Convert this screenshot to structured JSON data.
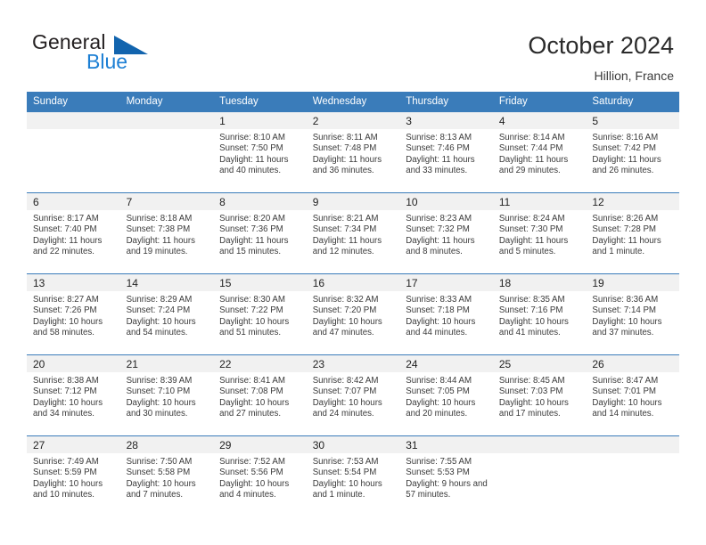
{
  "brand": {
    "name_top": "General",
    "name_bottom": "Blue",
    "accent_color": "#1c7fd4",
    "triangle_color": "#1264ae"
  },
  "header": {
    "title": "October 2024",
    "location": "Hillion, France",
    "header_bg": "#3a7cba",
    "band_bg": "#f1f1f1"
  },
  "weekdays": [
    {
      "label": "Sunday"
    },
    {
      "label": "Monday"
    },
    {
      "label": "Tuesday"
    },
    {
      "label": "Wednesday"
    },
    {
      "label": "Thursday"
    },
    {
      "label": "Friday"
    },
    {
      "label": "Saturday"
    }
  ],
  "weeks": [
    [
      {
        "day": "",
        "sunrise": "",
        "sunset": "",
        "daylight": ""
      },
      {
        "day": "",
        "sunrise": "",
        "sunset": "",
        "daylight": ""
      },
      {
        "day": "1",
        "sunrise": "Sunrise: 8:10 AM",
        "sunset": "Sunset: 7:50 PM",
        "daylight": "Daylight: 11 hours and 40 minutes."
      },
      {
        "day": "2",
        "sunrise": "Sunrise: 8:11 AM",
        "sunset": "Sunset: 7:48 PM",
        "daylight": "Daylight: 11 hours and 36 minutes."
      },
      {
        "day": "3",
        "sunrise": "Sunrise: 8:13 AM",
        "sunset": "Sunset: 7:46 PM",
        "daylight": "Daylight: 11 hours and 33 minutes."
      },
      {
        "day": "4",
        "sunrise": "Sunrise: 8:14 AM",
        "sunset": "Sunset: 7:44 PM",
        "daylight": "Daylight: 11 hours and 29 minutes."
      },
      {
        "day": "5",
        "sunrise": "Sunrise: 8:16 AM",
        "sunset": "Sunset: 7:42 PM",
        "daylight": "Daylight: 11 hours and 26 minutes."
      }
    ],
    [
      {
        "day": "6",
        "sunrise": "Sunrise: 8:17 AM",
        "sunset": "Sunset: 7:40 PM",
        "daylight": "Daylight: 11 hours and 22 minutes."
      },
      {
        "day": "7",
        "sunrise": "Sunrise: 8:18 AM",
        "sunset": "Sunset: 7:38 PM",
        "daylight": "Daylight: 11 hours and 19 minutes."
      },
      {
        "day": "8",
        "sunrise": "Sunrise: 8:20 AM",
        "sunset": "Sunset: 7:36 PM",
        "daylight": "Daylight: 11 hours and 15 minutes."
      },
      {
        "day": "9",
        "sunrise": "Sunrise: 8:21 AM",
        "sunset": "Sunset: 7:34 PM",
        "daylight": "Daylight: 11 hours and 12 minutes."
      },
      {
        "day": "10",
        "sunrise": "Sunrise: 8:23 AM",
        "sunset": "Sunset: 7:32 PM",
        "daylight": "Daylight: 11 hours and 8 minutes."
      },
      {
        "day": "11",
        "sunrise": "Sunrise: 8:24 AM",
        "sunset": "Sunset: 7:30 PM",
        "daylight": "Daylight: 11 hours and 5 minutes."
      },
      {
        "day": "12",
        "sunrise": "Sunrise: 8:26 AM",
        "sunset": "Sunset: 7:28 PM",
        "daylight": "Daylight: 11 hours and 1 minute."
      }
    ],
    [
      {
        "day": "13",
        "sunrise": "Sunrise: 8:27 AM",
        "sunset": "Sunset: 7:26 PM",
        "daylight": "Daylight: 10 hours and 58 minutes."
      },
      {
        "day": "14",
        "sunrise": "Sunrise: 8:29 AM",
        "sunset": "Sunset: 7:24 PM",
        "daylight": "Daylight: 10 hours and 54 minutes."
      },
      {
        "day": "15",
        "sunrise": "Sunrise: 8:30 AM",
        "sunset": "Sunset: 7:22 PM",
        "daylight": "Daylight: 10 hours and 51 minutes."
      },
      {
        "day": "16",
        "sunrise": "Sunrise: 8:32 AM",
        "sunset": "Sunset: 7:20 PM",
        "daylight": "Daylight: 10 hours and 47 minutes."
      },
      {
        "day": "17",
        "sunrise": "Sunrise: 8:33 AM",
        "sunset": "Sunset: 7:18 PM",
        "daylight": "Daylight: 10 hours and 44 minutes."
      },
      {
        "day": "18",
        "sunrise": "Sunrise: 8:35 AM",
        "sunset": "Sunset: 7:16 PM",
        "daylight": "Daylight: 10 hours and 41 minutes."
      },
      {
        "day": "19",
        "sunrise": "Sunrise: 8:36 AM",
        "sunset": "Sunset: 7:14 PM",
        "daylight": "Daylight: 10 hours and 37 minutes."
      }
    ],
    [
      {
        "day": "20",
        "sunrise": "Sunrise: 8:38 AM",
        "sunset": "Sunset: 7:12 PM",
        "daylight": "Daylight: 10 hours and 34 minutes."
      },
      {
        "day": "21",
        "sunrise": "Sunrise: 8:39 AM",
        "sunset": "Sunset: 7:10 PM",
        "daylight": "Daylight: 10 hours and 30 minutes."
      },
      {
        "day": "22",
        "sunrise": "Sunrise: 8:41 AM",
        "sunset": "Sunset: 7:08 PM",
        "daylight": "Daylight: 10 hours and 27 minutes."
      },
      {
        "day": "23",
        "sunrise": "Sunrise: 8:42 AM",
        "sunset": "Sunset: 7:07 PM",
        "daylight": "Daylight: 10 hours and 24 minutes."
      },
      {
        "day": "24",
        "sunrise": "Sunrise: 8:44 AM",
        "sunset": "Sunset: 7:05 PM",
        "daylight": "Daylight: 10 hours and 20 minutes."
      },
      {
        "day": "25",
        "sunrise": "Sunrise: 8:45 AM",
        "sunset": "Sunset: 7:03 PM",
        "daylight": "Daylight: 10 hours and 17 minutes."
      },
      {
        "day": "26",
        "sunrise": "Sunrise: 8:47 AM",
        "sunset": "Sunset: 7:01 PM",
        "daylight": "Daylight: 10 hours and 14 minutes."
      }
    ],
    [
      {
        "day": "27",
        "sunrise": "Sunrise: 7:49 AM",
        "sunset": "Sunset: 5:59 PM",
        "daylight": "Daylight: 10 hours and 10 minutes."
      },
      {
        "day": "28",
        "sunrise": "Sunrise: 7:50 AM",
        "sunset": "Sunset: 5:58 PM",
        "daylight": "Daylight: 10 hours and 7 minutes."
      },
      {
        "day": "29",
        "sunrise": "Sunrise: 7:52 AM",
        "sunset": "Sunset: 5:56 PM",
        "daylight": "Daylight: 10 hours and 4 minutes."
      },
      {
        "day": "30",
        "sunrise": "Sunrise: 7:53 AM",
        "sunset": "Sunset: 5:54 PM",
        "daylight": "Daylight: 10 hours and 1 minute."
      },
      {
        "day": "31",
        "sunrise": "Sunrise: 7:55 AM",
        "sunset": "Sunset: 5:53 PM",
        "daylight": "Daylight: 9 hours and 57 minutes."
      },
      {
        "day": "",
        "sunrise": "",
        "sunset": "",
        "daylight": ""
      },
      {
        "day": "",
        "sunrise": "",
        "sunset": "",
        "daylight": ""
      }
    ]
  ]
}
